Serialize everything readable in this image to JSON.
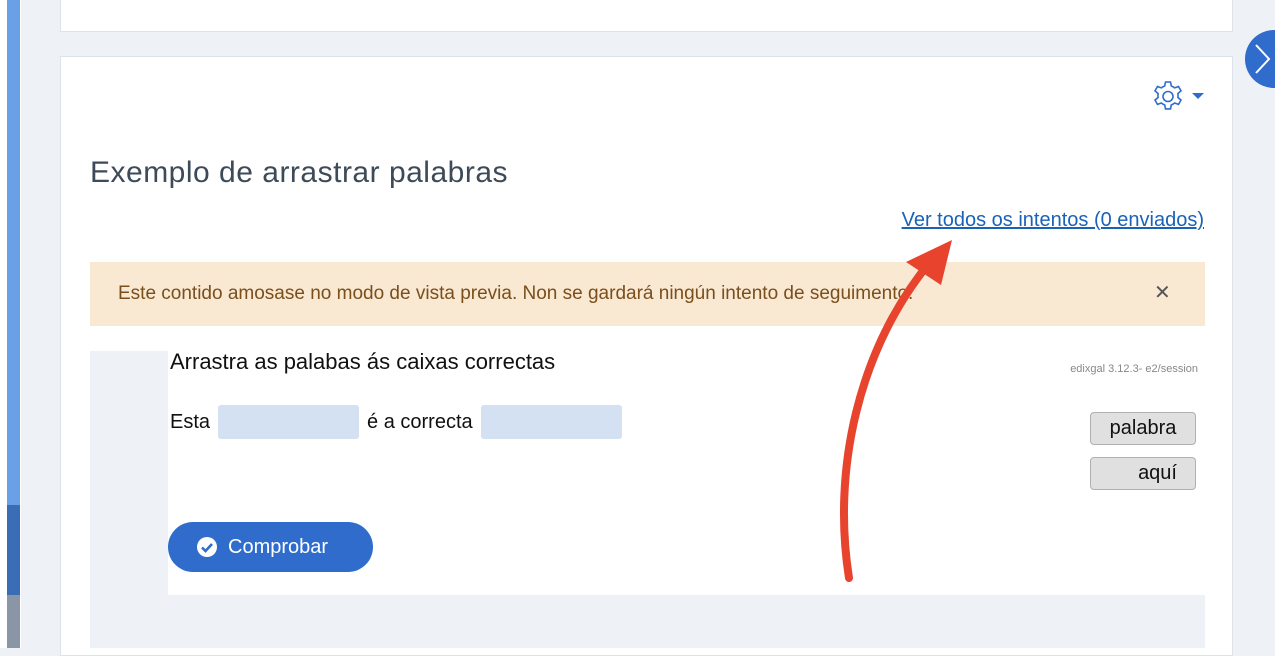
{
  "page": {
    "title": "Exemplo de arrastrar palabras",
    "attempts_link": "Ver todos os intentos (0 enviados)"
  },
  "notice": {
    "text": "Este contido amosase no modo de vista previa. Non se gardará ningún intento de seguimento.",
    "close_glyph": "✕"
  },
  "activity": {
    "title": "Arrastra as palabas ás caixas correctas",
    "version": "edixgal 3.12.3- e2/session",
    "sentence": {
      "part1": "Esta",
      "part2": "é a correcta"
    },
    "words": [
      "palabra",
      "aquí"
    ],
    "check_button": "Comprobar"
  },
  "icons": {
    "settings": "gear-icon",
    "dropdown": "caret-down-icon",
    "drawer_toggle": "chevron-right-icon",
    "check": "check-circle-icon",
    "close": "close-icon"
  },
  "colors": {
    "accent": "#2f6ccc",
    "link": "#1a62b8",
    "notice_bg": "#f9e8d2",
    "notice_text": "#7a4f1c",
    "drop_box": "#d3e1f3",
    "annotation_arrow": "#e8432c"
  }
}
